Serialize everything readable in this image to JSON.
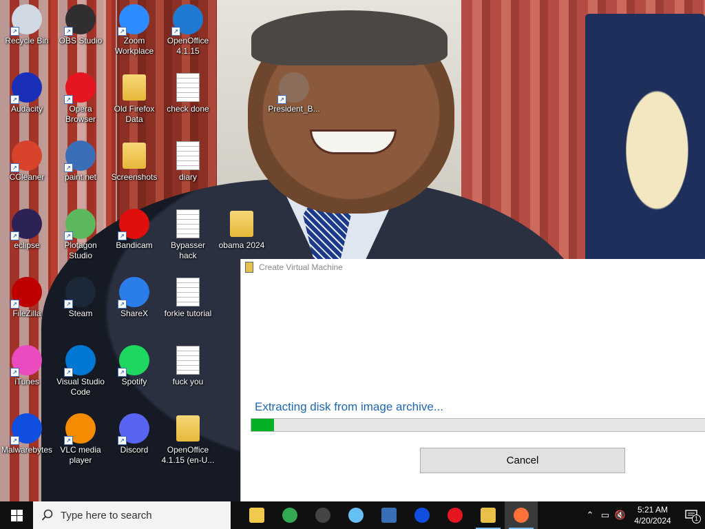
{
  "desktop": {
    "icons": [
      {
        "label": "Recycle Bin",
        "icon": "recycle-bin-icon",
        "color": "#cfd8e3"
      },
      {
        "label": "OBS Studio",
        "icon": "obs-icon",
        "color": "#302e31"
      },
      {
        "label": "Zoom Workplace",
        "icon": "zoom-icon",
        "color": "#2d8cff"
      },
      {
        "label": "OpenOffice 4.1.15",
        "icon": "openoffice-icon",
        "color": "#1e7bd1"
      },
      {
        "label": "Audacity",
        "icon": "audacity-icon",
        "color": "#1a2fb8"
      },
      {
        "label": "Opera Browser",
        "icon": "opera-icon",
        "color": "#e5161f"
      },
      {
        "label": "Old Firefox Data",
        "icon": "folder-icon",
        "color": "#f1c94c"
      },
      {
        "label": "check done",
        "icon": "text-document-icon",
        "color": "#ffffff"
      },
      {
        "label": "CCleaner",
        "icon": "ccleaner-icon",
        "color": "#d8442b"
      },
      {
        "label": "paint.net",
        "icon": "paintnet-icon",
        "color": "#3a6fb8"
      },
      {
        "label": "Screenshots",
        "icon": "folder-icon",
        "color": "#f1c94c"
      },
      {
        "label": "diary",
        "icon": "wordpad-document-icon",
        "color": "#ffffff"
      },
      {
        "label": "eclipse",
        "icon": "eclipse-icon",
        "color": "#2c2255"
      },
      {
        "label": "Plotagon Studio",
        "icon": "plotagon-icon",
        "color": "#5cb85c"
      },
      {
        "label": "Bandicam",
        "icon": "bandicam-icon",
        "color": "#e10e0e"
      },
      {
        "label": "Bypasser hack",
        "icon": "text-document-icon",
        "color": "#ffffff"
      },
      {
        "label": "FileZilla",
        "icon": "filezilla-icon",
        "color": "#bf0000"
      },
      {
        "label": "Steam",
        "icon": "steam-icon",
        "color": "#1b2838"
      },
      {
        "label": "ShareX",
        "icon": "sharex-icon",
        "color": "#2b7de9"
      },
      {
        "label": "forkie tutorial",
        "icon": "wordpad-document-icon",
        "color": "#ffffff"
      },
      {
        "label": "iTunes",
        "icon": "itunes-icon",
        "color": "#ea4cc0"
      },
      {
        "label": "Visual Studio Code",
        "icon": "vscode-icon",
        "color": "#0078d4"
      },
      {
        "label": "Spotify",
        "icon": "spotify-icon",
        "color": "#1ed760"
      },
      {
        "label": "fuck you",
        "icon": "text-document-icon",
        "color": "#ffffff"
      },
      {
        "label": "Malwarebytes",
        "icon": "malwarebytes-icon",
        "color": "#0f4ede"
      },
      {
        "label": "VLC media player",
        "icon": "vlc-icon",
        "color": "#f48b00"
      },
      {
        "label": "Discord",
        "icon": "discord-icon",
        "color": "#5865f2"
      },
      {
        "label": "OpenOffice 4.1.15 (en-U...",
        "icon": "folder-icon",
        "color": "#f1c94c"
      },
      {
        "label": "President_B...",
        "icon": "image-file-icon",
        "color": "#8a6d5a"
      },
      {
        "label": "obama 2024",
        "icon": "folder-icon",
        "color": "#f1c94c"
      }
    ]
  },
  "dialog": {
    "title": "Create Virtual Machine",
    "status": "Extracting disk from image archive...",
    "progress": 0.05,
    "cancel_label": "Cancel"
  },
  "taskbar": {
    "search_placeholder": "Type here to search",
    "apps": [
      {
        "name": "file-explorer-icon",
        "color": "#f1c94c"
      },
      {
        "name": "chrome-icon",
        "color": "#34a853"
      },
      {
        "name": "obs-icon",
        "color": "#444444"
      },
      {
        "name": "steam-icon",
        "color": "#66c0f4"
      },
      {
        "name": "paintnet-icon",
        "color": "#3a6fb8"
      },
      {
        "name": "malwarebytes-icon",
        "color": "#0f4ede"
      },
      {
        "name": "opera-icon",
        "color": "#e5161f"
      },
      {
        "name": "virtual-machine-icon",
        "color": "#e8c14a"
      },
      {
        "name": "firefox-icon",
        "color": "#ff7139"
      }
    ],
    "time": "5:21 AM",
    "date": "4/20/2024",
    "notification_count": "1"
  }
}
